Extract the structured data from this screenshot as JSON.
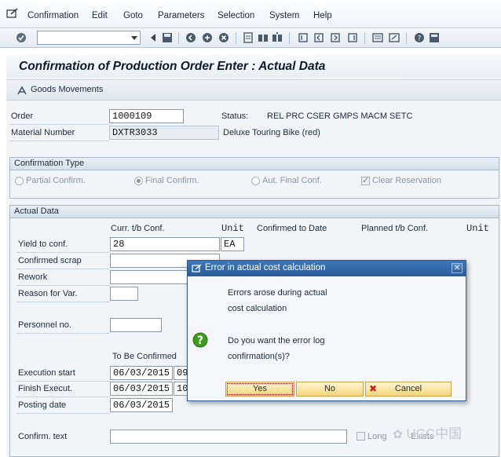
{
  "menu": {
    "items": [
      "Confirmation",
      "Edit",
      "Goto",
      "Parameters",
      "Selection",
      "System",
      "Help"
    ]
  },
  "toolbar": {
    "command_value": ""
  },
  "page": {
    "title": "Confirmation of Production Order Enter : Actual Data",
    "goods_movements_label": "Goods Movements"
  },
  "header": {
    "order_label": "Order",
    "order_value": "1000109",
    "status_label": "Status:",
    "status_value": "REL  PRC  CSER GMPS MACM SETC",
    "material_label": "Material Number",
    "material_value": "DXTR3033",
    "material_desc": "Deluxe Touring Bike (red)"
  },
  "confirmation_type": {
    "title": "Confirmation Type",
    "partial": "Partial Confirm.",
    "final": "Final Confirm.",
    "aut_final": "Aut. Final Conf.",
    "clear_reservation": "Clear Reservation"
  },
  "actual_data": {
    "title": "Actual Data",
    "col_curr": "Curr. t/b Conf.",
    "col_unit": "Unit",
    "col_confirmed": "Confirmed to Date",
    "col_planned": "Planned t/b Conf.",
    "col_unit2": "Unit",
    "yield_label": "Yield to conf.",
    "yield_value": "28",
    "yield_unit": "EA",
    "scrap_label": "Confirmed scrap",
    "rework_label": "Rework",
    "reason_label": "Reason for Var.",
    "personnel_label": "Personnel no.",
    "to_be_confirmed": "To Be Confirmed",
    "exec_start_label": "Execution start",
    "exec_start_date": "06/03/2015",
    "exec_start_time": "09",
    "finish_label": "Finish Execut.",
    "finish_date": "06/03/2015",
    "finish_time": "10",
    "posting_label": "Posting date",
    "posting_date": "06/03/2015",
    "confirm_text_label": "Confirm. text",
    "long_text_label": "Long",
    "exists_label": "Exists"
  },
  "dialog": {
    "title": "Error in actual cost calculation",
    "line1": "Errors arose during actual",
    "line2": "cost calculation",
    "line3": "Do you want the error log",
    "line4": "confirmation(s)?",
    "yes": "Yes",
    "no": "No",
    "cancel": "Cancel"
  },
  "watermark": "UCC中国",
  "colors": {
    "dialog_title": "#2a5c9a",
    "button_fill": "#f3d57a",
    "help_icon": "#3f9a1f",
    "cancel_icon": "#cc1f1f"
  }
}
